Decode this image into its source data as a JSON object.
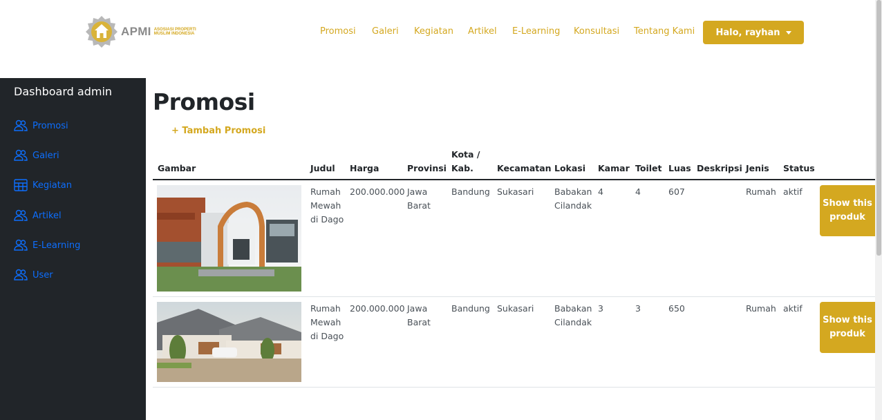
{
  "brand": {
    "name": "APMI",
    "subtitle_line1": "ASOSIASI PROPERTI",
    "subtitle_line2": "MUSLIM INDONESIA"
  },
  "nav": {
    "links": [
      "Promosi",
      "Galeri",
      "Kegiatan",
      "Artikel",
      "E-Learning",
      "Konsultasi",
      "Tentang Kami"
    ],
    "user_button": "Halo, rayhan"
  },
  "sidebar": {
    "title": "Dashboard admin",
    "items": [
      {
        "label": "Promosi",
        "icon": "users-icon"
      },
      {
        "label": "Galeri",
        "icon": "users-icon"
      },
      {
        "label": "Kegiatan",
        "icon": "table-icon"
      },
      {
        "label": "Artikel",
        "icon": "users-icon"
      },
      {
        "label": "E-Learning",
        "icon": "users-icon"
      },
      {
        "label": "User",
        "icon": "users-icon"
      }
    ]
  },
  "main": {
    "title": "Promosi",
    "add_link": "+ Tambah Promosi",
    "columns": [
      "Gambar",
      "Judul",
      "Harga",
      "Provinsi",
      "Kota / Kab.",
      "Kecamatan",
      "Lokasi",
      "Kamar",
      "Toilet",
      "Luas",
      "Deskripsi",
      "Jenis",
      "Status"
    ],
    "rows": [
      {
        "judul": "Rumah Mewah di Dago",
        "harga": "200.000.000",
        "provinsi": "Jawa Barat",
        "kota": "Bandung",
        "kecamatan": "Sukasari",
        "lokasi": "Babakan Cilandak",
        "kamar": "4",
        "toilet": "4",
        "luas": "607",
        "deskripsi": "",
        "jenis": "Rumah",
        "status": "aktif",
        "button": "Show this produk"
      },
      {
        "judul": "Rumah Mewah di Dago",
        "harga": "200.000.000",
        "provinsi": "Jawa Barat",
        "kota": "Bandung",
        "kecamatan": "Sukasari",
        "lokasi": "Babakan Cilandak",
        "kamar": "3",
        "toilet": "3",
        "luas": "650",
        "deskripsi": "",
        "jenis": "Rumah",
        "status": "aktif",
        "button": "Show this produk"
      }
    ]
  },
  "colors": {
    "accent": "#d4a820",
    "sidebar_bg": "#212529",
    "link_blue": "#0d6efd"
  }
}
